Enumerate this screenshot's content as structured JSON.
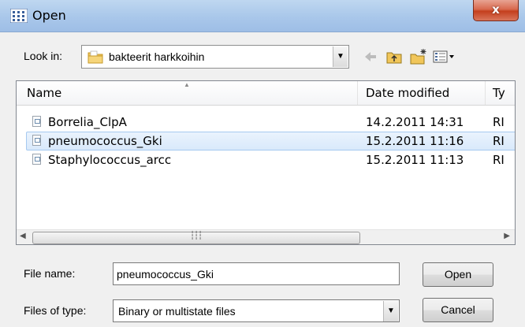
{
  "window": {
    "title": "Open",
    "close_label": "x"
  },
  "lookin": {
    "label": "Look in:",
    "value": "bakteerit harkkoihin"
  },
  "filelist": {
    "columns": {
      "name": "Name",
      "date": "Date modified",
      "type": "Ty"
    },
    "rows": [
      {
        "name": "Borrelia_ClpA",
        "date": "14.2.2011 14:31",
        "type": "RI"
      },
      {
        "name": "pneumococcus_Gki",
        "date": "15.2.2011 11:16",
        "type": "RI"
      },
      {
        "name": "Staphylococcus_arcc",
        "date": "15.2.2011 11:13",
        "type": "RI"
      }
    ],
    "selected_index": 1
  },
  "filename": {
    "label": "File name:",
    "value": "pneumococcus_Gki"
  },
  "filetype": {
    "label": "Files of type:",
    "value": "Binary or multistate files"
  },
  "buttons": {
    "open": "Open",
    "cancel": "Cancel"
  },
  "icons": {
    "app": "app-grid-icon",
    "folder": "folder-icon",
    "back": "back-arrow-icon",
    "up": "up-folder-icon",
    "new_folder": "new-folder-icon",
    "views": "view-menu-icon"
  },
  "colors": {
    "selection": "#d9e9fb",
    "close_button": "#c43f1d"
  }
}
